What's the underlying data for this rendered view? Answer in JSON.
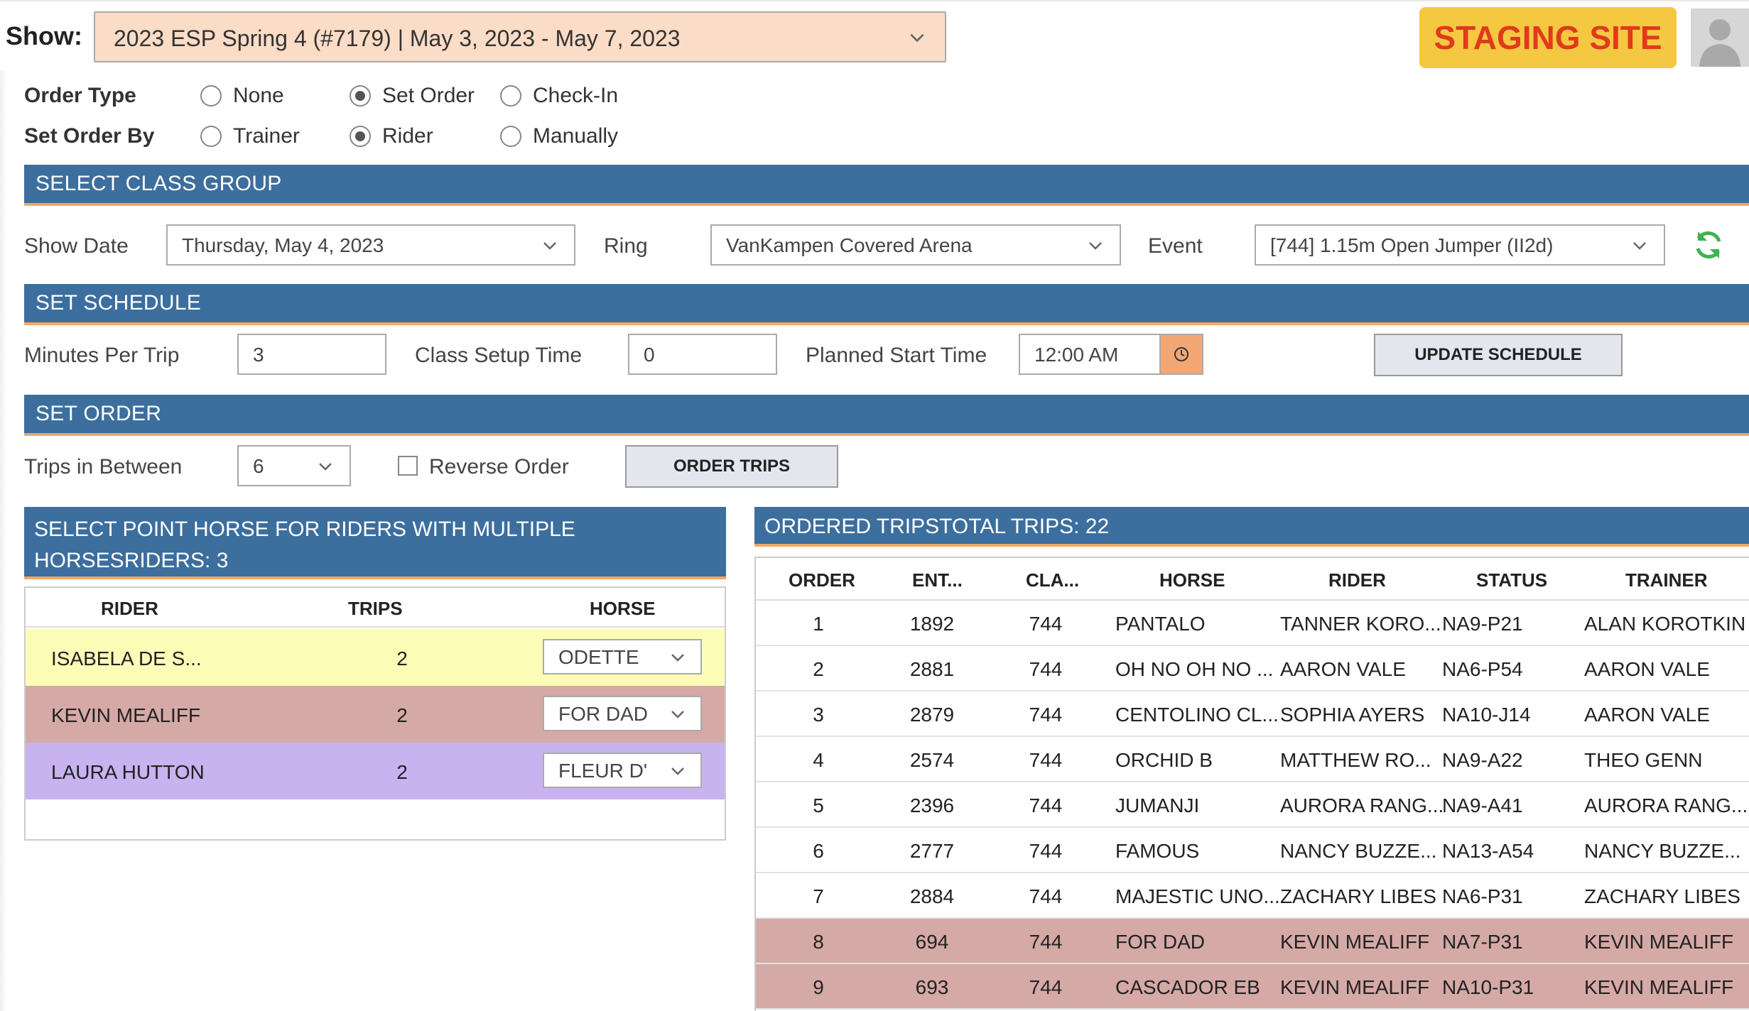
{
  "header": {
    "show_label": "Show:",
    "show_value": "2023 ESP Spring 4 (#7179) | May 3, 2023 - May 7, 2023",
    "staging_label": "STAGING SITE"
  },
  "order_type": {
    "label": "Order Type",
    "options": [
      "None",
      "Set Order",
      "Check-In"
    ],
    "selected": "Set Order"
  },
  "set_order_by": {
    "label": "Set Order By",
    "options": [
      "Trainer",
      "Rider",
      "Manually"
    ],
    "selected": "Rider"
  },
  "class_group": {
    "title": "SELECT CLASS GROUP",
    "show_date_label": "Show Date",
    "show_date": "Thursday, May 4, 2023",
    "ring_label": "Ring",
    "ring": "VanKampen Covered Arena",
    "event_label": "Event",
    "event": "[744] 1.15m Open Jumper (II2d)"
  },
  "schedule": {
    "title": "SET SCHEDULE",
    "minutes_label": "Minutes Per Trip",
    "minutes": "3",
    "setup_label": "Class Setup Time",
    "setup": "0",
    "start_label": "Planned Start Time",
    "start": "12:00 AM",
    "update_button": "UPDATE SCHEDULE"
  },
  "set_order": {
    "title": "SET ORDER",
    "trips_between_label": "Trips in Between",
    "trips_between": "6",
    "reverse_label": "Reverse Order",
    "order_button": "ORDER TRIPS"
  },
  "point_horse": {
    "title": "SELECT POINT HORSE FOR RIDERS WITH MULTIPLE HORSESRIDERS: 3",
    "headers": {
      "rider": "RIDER",
      "trips": "TRIPS",
      "horse": "HORSE"
    },
    "rows": [
      {
        "rider": "ISABELA DE S...",
        "trips": "2",
        "horse": "ODETTE",
        "color": "#fdfdb8"
      },
      {
        "rider": "KEVIN MEALIFF",
        "trips": "2",
        "horse": "FOR DAD",
        "color": "#d5a9a6"
      },
      {
        "rider": "LAURA HUTTON",
        "trips": "2",
        "horse": "FLEUR D'",
        "color": "#c8b2ef"
      }
    ]
  },
  "ordered_trips": {
    "title": "ORDERED TRIPSTOTAL TRIPS: 22",
    "headers": {
      "order": "ORDER",
      "entry": "ENT...",
      "class": "CLA...",
      "horse": "HORSE",
      "rider": "RIDER",
      "status": "STATUS",
      "trainer": "TRAINER"
    },
    "rows": [
      {
        "order": "1",
        "entry": "1892",
        "class": "744",
        "horse": "PANTALO",
        "rider": "TANNER KORO...",
        "status": "NA9-P21",
        "trainer": "ALAN KOROTKIN",
        "highlight": false
      },
      {
        "order": "2",
        "entry": "2881",
        "class": "744",
        "horse": "OH NO OH NO ...",
        "rider": "AARON VALE",
        "status": "NA6-P54",
        "trainer": "AARON VALE",
        "highlight": false
      },
      {
        "order": "3",
        "entry": "2879",
        "class": "744",
        "horse": "CENTOLINO CL...",
        "rider": "SOPHIA AYERS",
        "status": "NA10-J14",
        "trainer": "AARON VALE",
        "highlight": false
      },
      {
        "order": "4",
        "entry": "2574",
        "class": "744",
        "horse": "ORCHID B",
        "rider": "MATTHEW RO...",
        "status": "NA9-A22",
        "trainer": "THEO GENN",
        "highlight": false
      },
      {
        "order": "5",
        "entry": "2396",
        "class": "744",
        "horse": "JUMANJI",
        "rider": "AURORA RANG...",
        "status": "NA9-A41",
        "trainer": "AURORA RANG...",
        "highlight": false
      },
      {
        "order": "6",
        "entry": "2777",
        "class": "744",
        "horse": "FAMOUS",
        "rider": "NANCY BUZZE...",
        "status": "NA13-A54",
        "trainer": "NANCY BUZZE...",
        "highlight": false
      },
      {
        "order": "7",
        "entry": "2884",
        "class": "744",
        "horse": "MAJESTIC UNO...",
        "rider": "ZACHARY LIBES",
        "status": "NA6-P31",
        "trainer": "ZACHARY LIBES",
        "highlight": false
      },
      {
        "order": "8",
        "entry": "694",
        "class": "744",
        "horse": "FOR DAD",
        "rider": "KEVIN MEALIFF",
        "status": "NA7-P31",
        "trainer": "KEVIN MEALIFF",
        "highlight": true
      },
      {
        "order": "9",
        "entry": "693",
        "class": "744",
        "horse": "CASCADOR EB",
        "rider": "KEVIN MEALIFF",
        "status": "NA10-P31",
        "trainer": "KEVIN MEALIFF",
        "highlight": true
      }
    ],
    "highlight_color": "#d5a9a6"
  },
  "colors": {
    "section_bg": "#3c6e9e",
    "section_accent": "#f0a868",
    "show_select_bg": "#fbdcc7",
    "staging_bg": "#f5c842",
    "staging_text": "#e03a1c",
    "clock_btn": "#f3a774",
    "refresh": "#3fb34f"
  }
}
